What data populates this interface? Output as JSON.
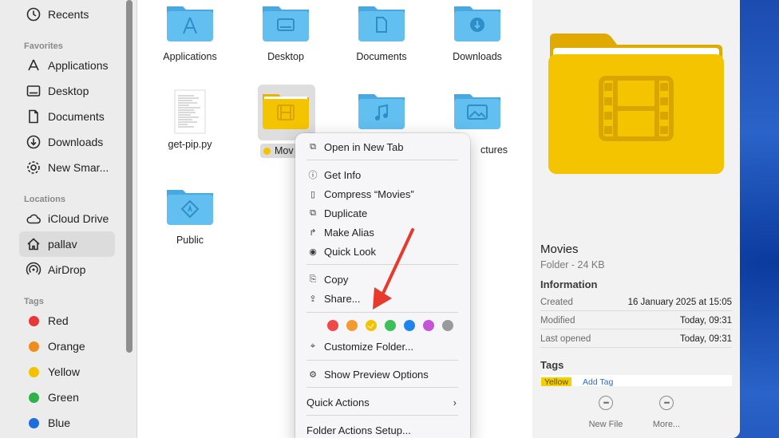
{
  "sidebar": {
    "recents": "Recents",
    "favorites_header": "Favorites",
    "favorites": [
      "Applications",
      "Desktop",
      "Documents",
      "Downloads",
      "New Smar..."
    ],
    "locations_header": "Locations",
    "locations": [
      "iCloud Drive",
      "pallav",
      "AirDrop"
    ],
    "tags_header": "Tags",
    "tags": [
      {
        "label": "Red",
        "color": "#e8373a"
      },
      {
        "label": "Orange",
        "color": "#f08c1e"
      },
      {
        "label": "Yellow",
        "color": "#f2c200"
      },
      {
        "label": "Green",
        "color": "#2fb24a"
      },
      {
        "label": "Blue",
        "color": "#1a6ddc"
      }
    ]
  },
  "files": {
    "applications": "Applications",
    "desktop": "Desktop",
    "documents": "Documents",
    "downloads": "Downloads",
    "getpip": "get-pip.py",
    "movies": "Mov",
    "pictures": "ctures",
    "public": "Public"
  },
  "menu": {
    "open_new_tab": "Open in New Tab",
    "get_info": "Get Info",
    "compress": "Compress “Movies”",
    "duplicate": "Duplicate",
    "make_alias": "Make Alias",
    "quick_look": "Quick Look",
    "copy": "Copy",
    "share": "Share...",
    "tag_colors": [
      "#f0494a",
      "#f49a32",
      "#f5c200",
      "#3cc15a",
      "#1f84f0",
      "#c554d8",
      "#9a9a9a"
    ],
    "customize_folder": "Customize Folder...",
    "show_preview_options": "Show Preview Options",
    "quick_actions": "Quick Actions",
    "folder_actions_setup": "Folder Actions Setup..."
  },
  "preview": {
    "title": "Movies",
    "subtitle": "Folder - 24 KB",
    "information_header": "Information",
    "rows": [
      {
        "key": "Created",
        "value": "16 January 2025 at 15:05"
      },
      {
        "key": "Modified",
        "value": "Today, 09:31"
      },
      {
        "key": "Last opened",
        "value": "Today, 09:31"
      }
    ],
    "tags_header": "Tags",
    "tag_chip": "Yellow",
    "add_tag": "Add Tag",
    "new_file": "New File",
    "more": "More..."
  },
  "colors": {
    "folder_blue": "#5bb8ec",
    "folder_yellow": "#f5c400",
    "arrow_red": "#e8392f"
  }
}
